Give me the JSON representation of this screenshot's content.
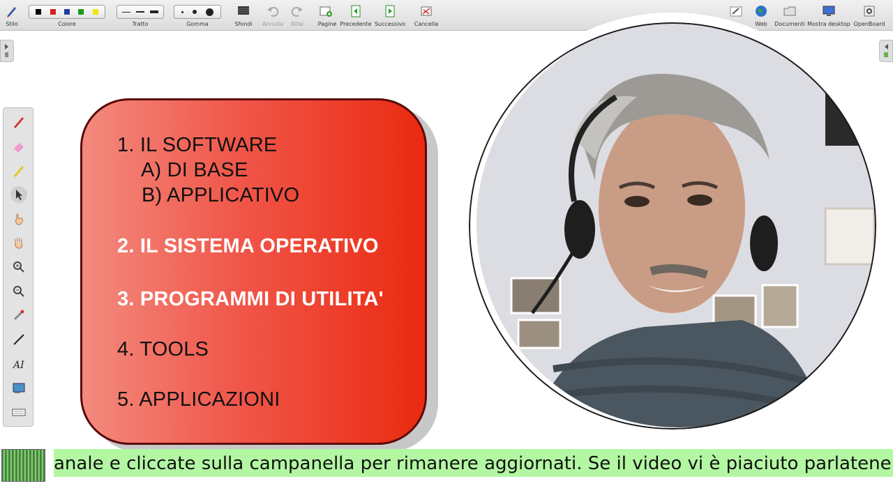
{
  "toolbar": {
    "stilo": "Stilo",
    "colore": "Colore",
    "tratto": "Tratto",
    "gomma": "Gomma",
    "sfondi": "Sfondi",
    "annulla": "Annulla",
    "rifai": "Rifai",
    "pagine": "Pagine",
    "precedente": "Precedente",
    "successivo": "Successivo",
    "cancella": "Cancella",
    "web": "Web",
    "documenti": "Documenti",
    "mostra_desktop": "Mostra desktop",
    "openboard": "OpenBoard",
    "colors": [
      "#000000",
      "#d81f1f",
      "#1f3f9e",
      "#1d9a1d",
      "#f2e312"
    ]
  },
  "menu": {
    "item1": "1. IL SOFTWARE",
    "item1a": "A) DI BASE",
    "item1b": "B) APPLICATIVO",
    "item2": "2. IL SISTEMA OPERATIVO",
    "item3": "3. PROGRAMMI DI UTILITA'",
    "item4": "4. TOOLS",
    "item5": "5. APPLICAZIONI"
  },
  "ticker": {
    "text": "anale e cliccate sulla campanella per rimanere aggiornati. Se il video vi è piaciuto parlatene b"
  },
  "icons": [
    "pen-icon",
    "eraser-icon",
    "highlighter-icon",
    "pointer-icon",
    "hand-icon",
    "zoom-in-icon",
    "zoom-out-icon",
    "laser-pointer-icon",
    "line-icon",
    "text-icon",
    "capture-icon",
    "keyboard-icon"
  ]
}
